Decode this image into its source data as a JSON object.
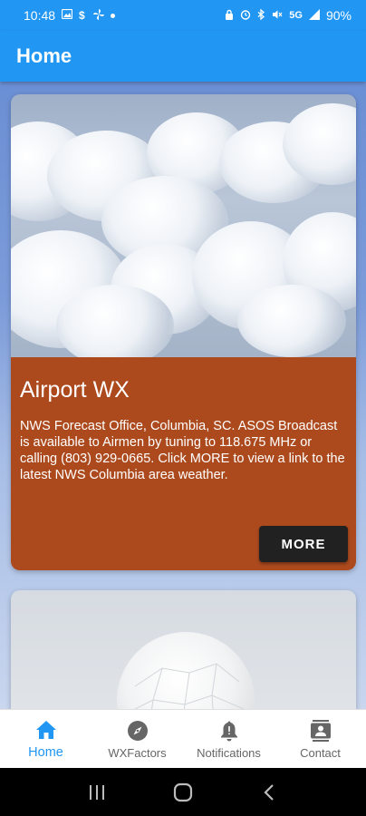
{
  "status_bar": {
    "time": "10:48",
    "battery": "90%",
    "network": "5G"
  },
  "app_bar": {
    "title": "Home"
  },
  "cards": [
    {
      "title": "Airport WX",
      "text": "NWS Forecast Office, Columbia, SC. ASOS Broadcast is available to Airmen by tuning to 118.675 MHz or calling (803) 929-0665.  Click MORE to view a link to the latest NWS Columbia area weather.",
      "button_label": "MORE",
      "body_color": "#ac4a1e"
    }
  ],
  "bottom_nav": {
    "items": [
      {
        "label": "Home",
        "icon": "home-icon",
        "active": true
      },
      {
        "label": "WXFactors",
        "icon": "compass-icon",
        "active": false
      },
      {
        "label": "Notifications",
        "icon": "bell-alert-icon",
        "active": false
      },
      {
        "label": "Contact",
        "icon": "contact-card-icon",
        "active": false
      }
    ]
  },
  "colors": {
    "primary": "#2196f3",
    "card_body": "#ac4a1e",
    "button": "#212121"
  }
}
